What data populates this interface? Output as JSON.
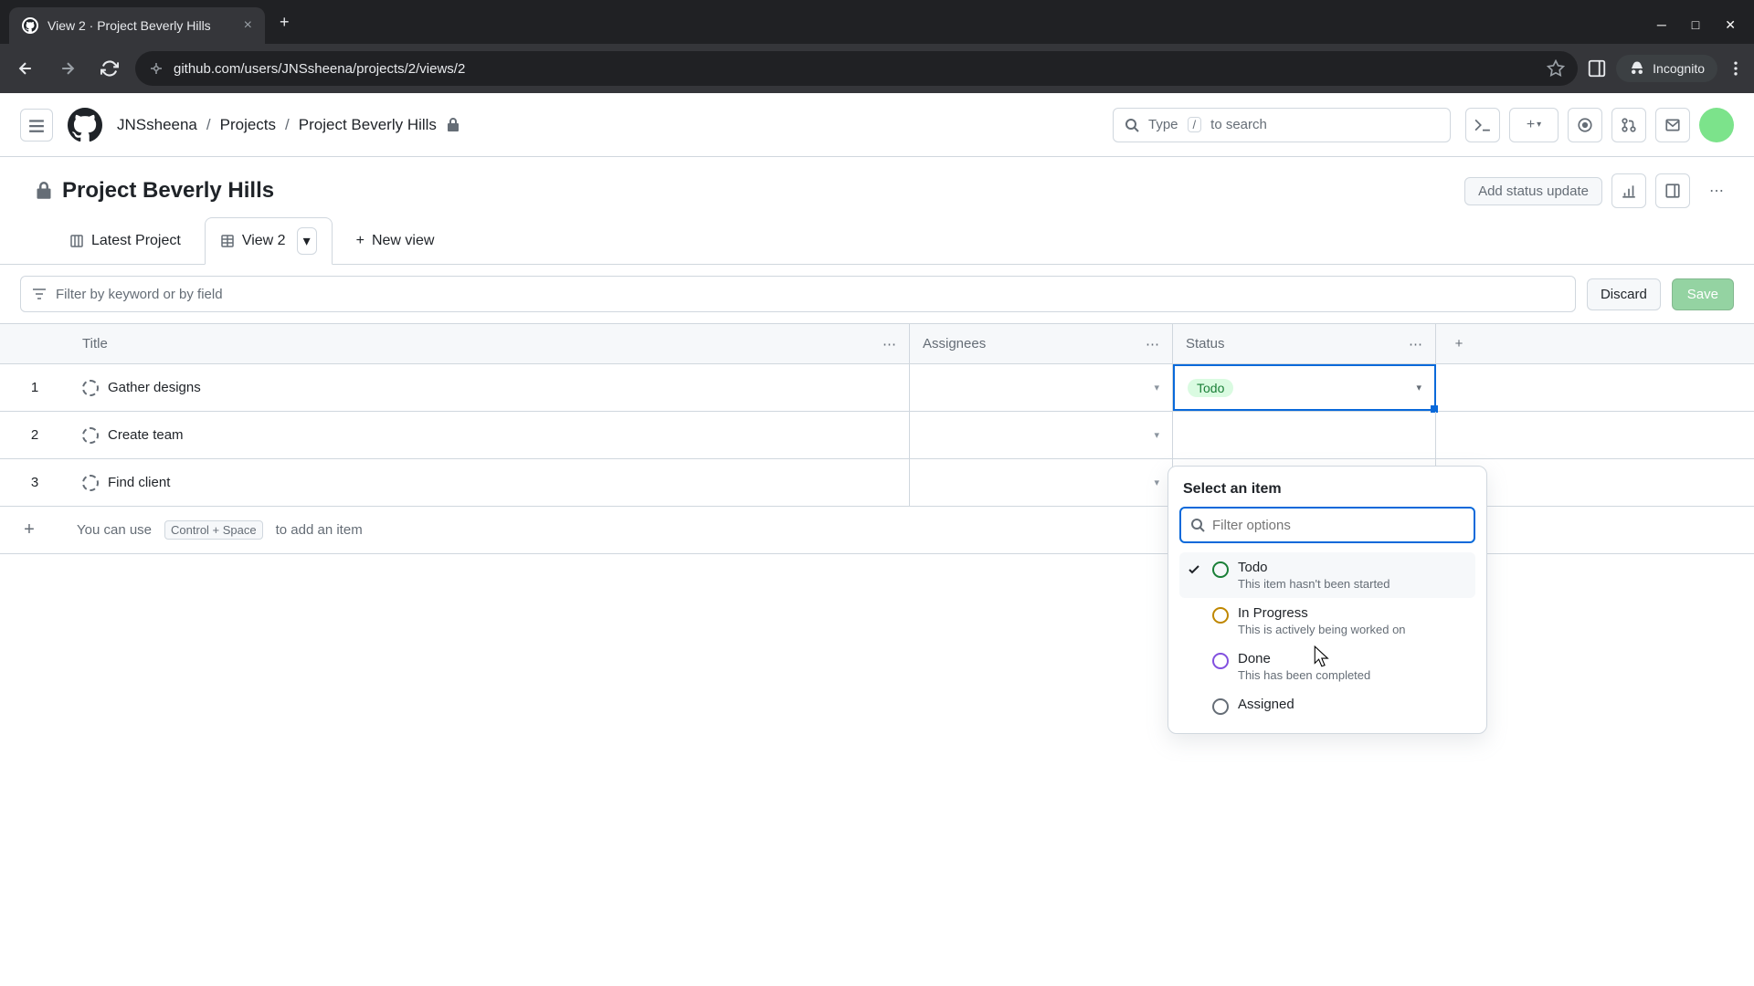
{
  "browser": {
    "tab_title": "View 2 · Project Beverly Hills",
    "url": "github.com/users/JNSsheena/projects/2/views/2",
    "incognito": "Incognito"
  },
  "header": {
    "breadcrumb": [
      "JNSsheena",
      "Projects",
      "Project Beverly Hills"
    ],
    "search_placeholder": "Type",
    "search_key": "/",
    "search_suffix": "to search"
  },
  "project": {
    "title": "Project Beverly Hills",
    "add_status": "Add status update"
  },
  "views": {
    "tab1": "Latest Project",
    "tab2": "View 2",
    "new_view": "New view"
  },
  "filter": {
    "placeholder": "Filter by keyword or by field",
    "discard": "Discard",
    "save": "Save"
  },
  "columns": {
    "title": "Title",
    "assignees": "Assignees",
    "status": "Status"
  },
  "rows": [
    {
      "num": "1",
      "title": "Gather designs",
      "status": "Todo"
    },
    {
      "num": "2",
      "title": "Create team",
      "status": ""
    },
    {
      "num": "3",
      "title": "Find client",
      "status": ""
    }
  ],
  "add_item": {
    "prefix": "You can use",
    "key": "Control + Space",
    "suffix": "to add an item"
  },
  "dropdown": {
    "title": "Select an item",
    "filter_placeholder": "Filter options",
    "options": [
      {
        "label": "Todo",
        "desc": "This item hasn't been started",
        "selected": true,
        "color": "green"
      },
      {
        "label": "In Progress",
        "desc": "This is actively being worked on",
        "selected": false,
        "color": "yellow"
      },
      {
        "label": "Done",
        "desc": "This has been completed",
        "selected": false,
        "color": "purple"
      },
      {
        "label": "Assigned",
        "desc": "",
        "selected": false,
        "color": "gray"
      }
    ]
  }
}
